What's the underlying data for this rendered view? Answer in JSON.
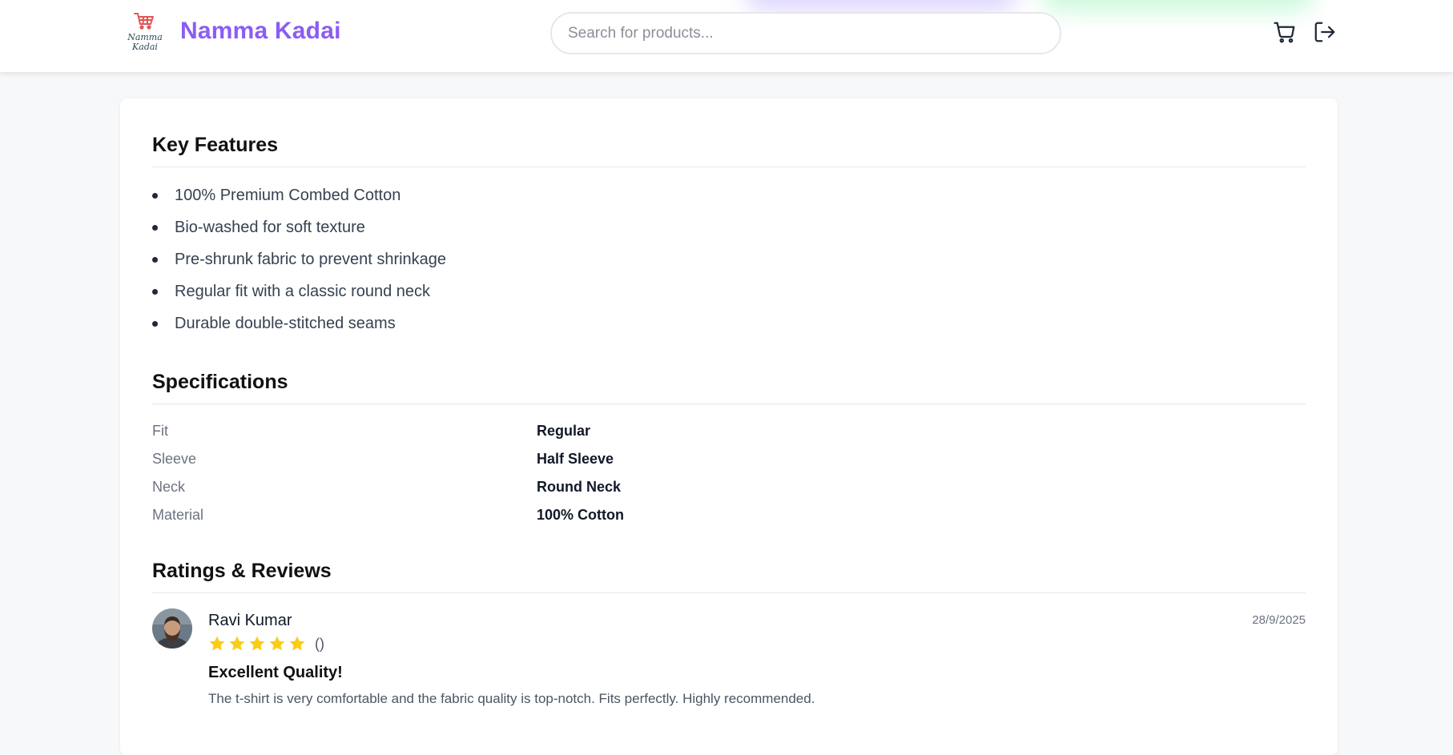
{
  "header": {
    "brand": "Namma Kadai",
    "logo_text_line1": "Namma",
    "logo_text_line2": "Kadai",
    "search_placeholder": "Search for products...",
    "cart_icon": "cart-icon",
    "logout_icon": "logout-icon"
  },
  "colors": {
    "brand": "#8b5cf6",
    "star": "#facc15",
    "logo_cart": "#e25555"
  },
  "features": {
    "title": "Key Features",
    "items": [
      "100% Premium Combed Cotton",
      "Bio-washed for soft texture",
      "Pre-shrunk fabric to prevent shrinkage",
      "Regular fit with a classic round neck",
      "Durable double-stitched seams"
    ]
  },
  "specifications": {
    "title": "Specifications",
    "rows": [
      {
        "label": "Fit",
        "value": "Regular"
      },
      {
        "label": "Sleeve",
        "value": "Half Sleeve"
      },
      {
        "label": "Neck",
        "value": "Round Neck"
      },
      {
        "label": "Material",
        "value": "100% Cotton"
      }
    ]
  },
  "reviews": {
    "title": "Ratings & Reviews",
    "items": [
      {
        "author": "Ravi Kumar",
        "date": "28/9/2025",
        "rating": 5,
        "rating_count": "()",
        "title": "Excellent Quality!",
        "text": "The t-shirt is very comfortable and the fabric quality is top-notch. Fits perfectly. Highly recommended."
      }
    ]
  }
}
